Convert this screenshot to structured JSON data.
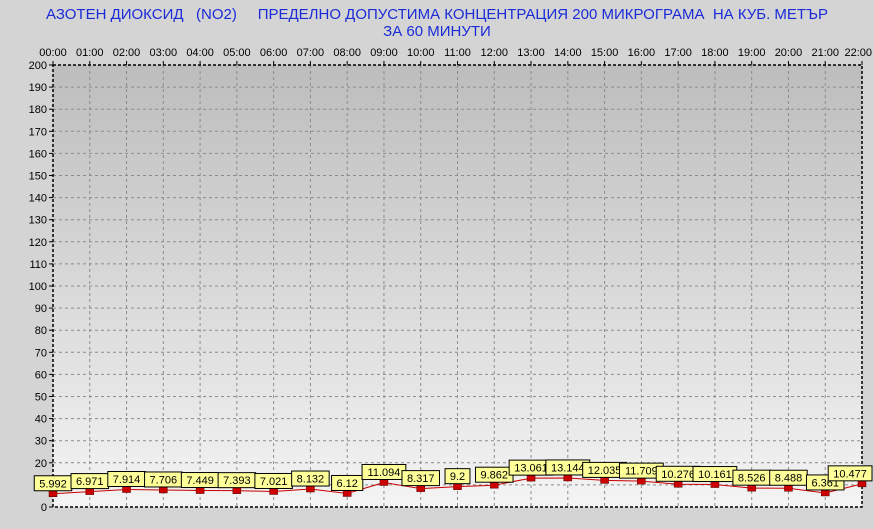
{
  "chart_data": {
    "type": "line",
    "title_lines": [
      "АЗОТЕН ДИОКСИД   (NO2)     ПРЕДЕЛНО ДОПУСТИМА КОНЦЕНТРАЦИЯ 200 МИКРОГРАМА  НА КУБ. МЕТЪР",
      "ЗА 60 МИНУТИ"
    ],
    "x": [
      "00:00",
      "01:00",
      "02:00",
      "03:00",
      "04:00",
      "05:00",
      "06:00",
      "07:00",
      "08:00",
      "09:00",
      "10:00",
      "11:00",
      "12:00",
      "13:00",
      "14:00",
      "15:00",
      "16:00",
      "17:00",
      "18:00",
      "19:00",
      "20:00",
      "21:00",
      "22:00"
    ],
    "series": [
      {
        "values": [
          5.992,
          6.971,
          7.914,
          7.706,
          7.449,
          7.393,
          7.021,
          8.132,
          6.12,
          11.094,
          8.317,
          9.2,
          9.862,
          13.061,
          13.144,
          12.035,
          11.709,
          10.276,
          10.161,
          8.526,
          8.488,
          6.361,
          10.477
        ],
        "labels": [
          "5.992",
          "6.971",
          "7.914",
          "7.706",
          "7.449",
          "7.393",
          "7.021",
          "8.132",
          "6.12",
          "11.094",
          "8.317",
          "9.2",
          "9.862",
          "13.061",
          "13.144",
          "12.035",
          "11.709",
          "10.276",
          "10.161",
          "8.526",
          "8.488",
          "6.361",
          "10.477"
        ],
        "color": "#cc0000",
        "label_bg": "#ffff99"
      }
    ],
    "y_ticks": [
      0,
      10,
      20,
      30,
      40,
      50,
      60,
      70,
      80,
      90,
      100,
      110,
      120,
      130,
      140,
      150,
      160,
      170,
      180,
      190,
      200
    ],
    "ylim": [
      0,
      200
    ],
    "x_axis_position": "top",
    "grid": true,
    "colors": {
      "plot_top": "#bdbdbd",
      "plot_bottom": "#f4f4f4",
      "grid": "#8c8c8c",
      "title": "#1a2bd8",
      "marker": "#cc0000"
    }
  }
}
